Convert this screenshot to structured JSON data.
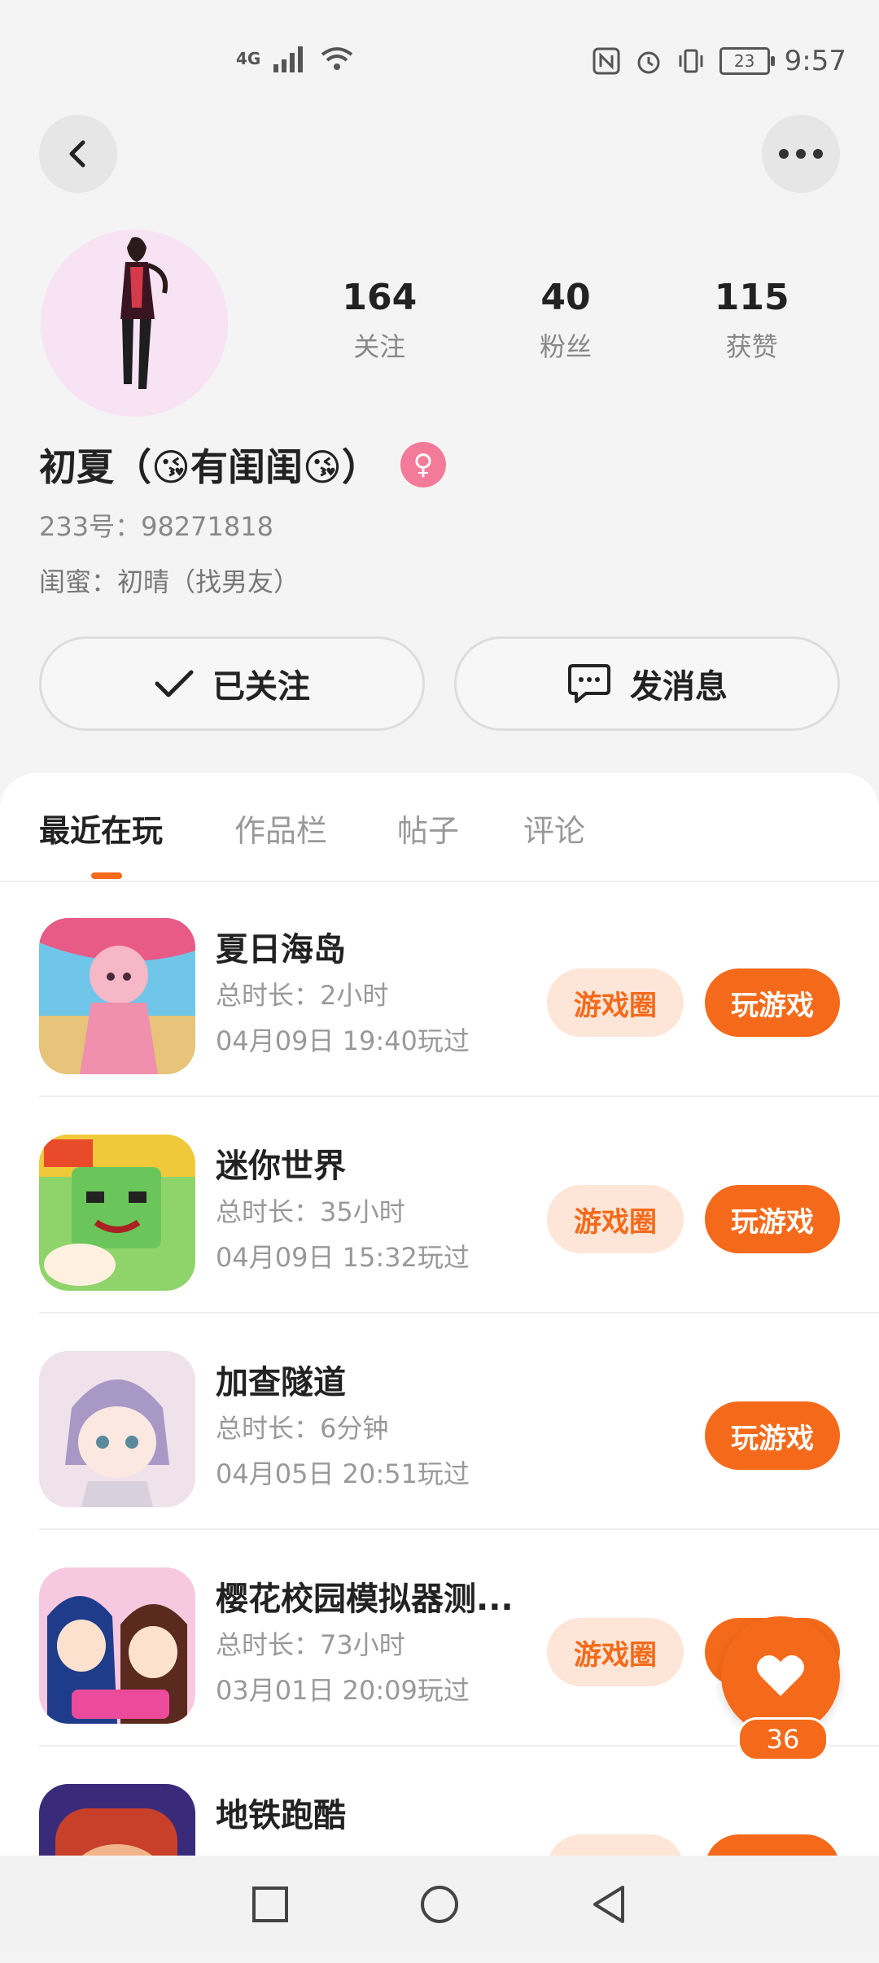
{
  "status_bar": {
    "network": "4G",
    "battery": "23",
    "time": "9:57"
  },
  "profile": {
    "stats": [
      {
        "value": "164",
        "label": "关注"
      },
      {
        "value": "40",
        "label": "粉丝"
      },
      {
        "value": "115",
        "label": "获赞"
      }
    ],
    "username": "初夏（😘有闺闺😘）",
    "id_line": "233号：98271818",
    "bff_line": "闺蜜：初晴（找男友）"
  },
  "actions": {
    "follow_label": "已关注",
    "message_label": "发消息"
  },
  "tabs": [
    {
      "label": "最近在玩",
      "active": true
    },
    {
      "label": "作品栏",
      "active": false
    },
    {
      "label": "帖子",
      "active": false
    },
    {
      "label": "评论",
      "active": false
    }
  ],
  "games": [
    {
      "name": "夏日海岛",
      "duration": "总时长：2小时",
      "last_played": "04月09日 19:40玩过",
      "circle_label": "游戏圈",
      "play_label": "玩游戏"
    },
    {
      "name": "迷你世界",
      "duration": "总时长：35小时",
      "last_played": "04月09日 15:32玩过",
      "circle_label": "游戏圈",
      "play_label": "玩游戏"
    },
    {
      "name": "加查隧道",
      "duration": "总时长：6分钟",
      "last_played": "04月05日 20:51玩过",
      "circle_label": "",
      "play_label": "玩游戏"
    },
    {
      "name": "樱花校园模拟器测...",
      "duration": "总时长：73小时",
      "last_played": "03月01日 20:09玩过",
      "circle_label": "游戏圈",
      "play_label": "玩游戏"
    },
    {
      "name": "地铁跑酷",
      "duration": "",
      "last_played": "",
      "circle_label": "游戏圈",
      "play_label": "玩游戏"
    }
  ],
  "like_fab": {
    "count": "36"
  },
  "colors": {
    "accent": "#f56a1a",
    "accent_light": "#fde6d8",
    "gender": "#f47a9a"
  }
}
